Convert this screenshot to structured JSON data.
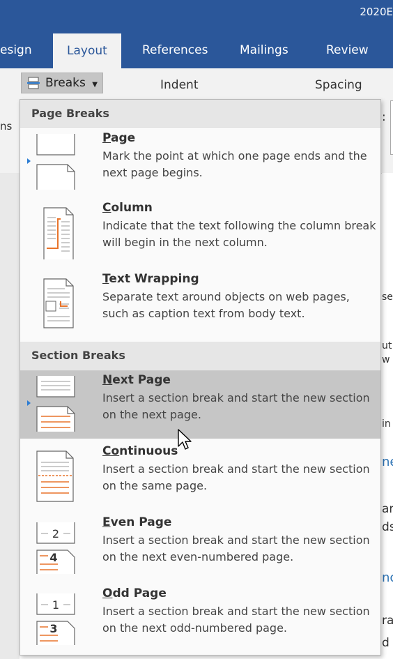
{
  "window": {
    "title_fragment": "2020E"
  },
  "tabs": [
    {
      "label": "esign"
    },
    {
      "label": "Layout",
      "active": true
    },
    {
      "label": "References"
    },
    {
      "label": "Mailings"
    },
    {
      "label": "Review"
    }
  ],
  "ribbon": {
    "breaks_label": "Breaks",
    "indent_label": "Indent",
    "spacing_label": "Spacing",
    "left_fragment": "ns",
    "colon": ":"
  },
  "menu": {
    "page_breaks_header": "Page Breaks",
    "section_breaks_header": "Section Breaks",
    "items": [
      {
        "title_first": "P",
        "title_rest": "age",
        "desc": "Mark the point at which one page ends and the next page begins."
      },
      {
        "title_first": "C",
        "title_rest": "olumn",
        "desc": "Indicate that the text following the column break will begin in the next column."
      },
      {
        "title_first": "T",
        "title_rest": "ext Wrapping",
        "desc": "Separate text around objects on web pages, such as caption text from body text."
      },
      {
        "title_first": "N",
        "title_rest": "ext Page",
        "desc": "Insert a section break and start the new section on the next page."
      },
      {
        "title_first": "Co",
        "title_rest": "ntinuous",
        "desc": "Insert a section break and start the new section on the same page."
      },
      {
        "title_first": "E",
        "title_rest": "ven Page",
        "desc": "Insert a section break and start the new section on the next even-numbered page."
      },
      {
        "title_first": "O",
        "title_rest": "dd Page",
        "desc": "Insert a section break and start the new section on the next odd-numbered page."
      }
    ]
  },
  "doc_fragments": [
    "se",
    "ut",
    "w",
    "in",
    "ne",
    "an",
    "ds",
    "nc",
    "ra",
    "d"
  ],
  "colors": {
    "accent": "#2b579a",
    "hover": "#c6c6c6",
    "marker": "#2b7cd3",
    "icon_orange": "#e8742c"
  }
}
